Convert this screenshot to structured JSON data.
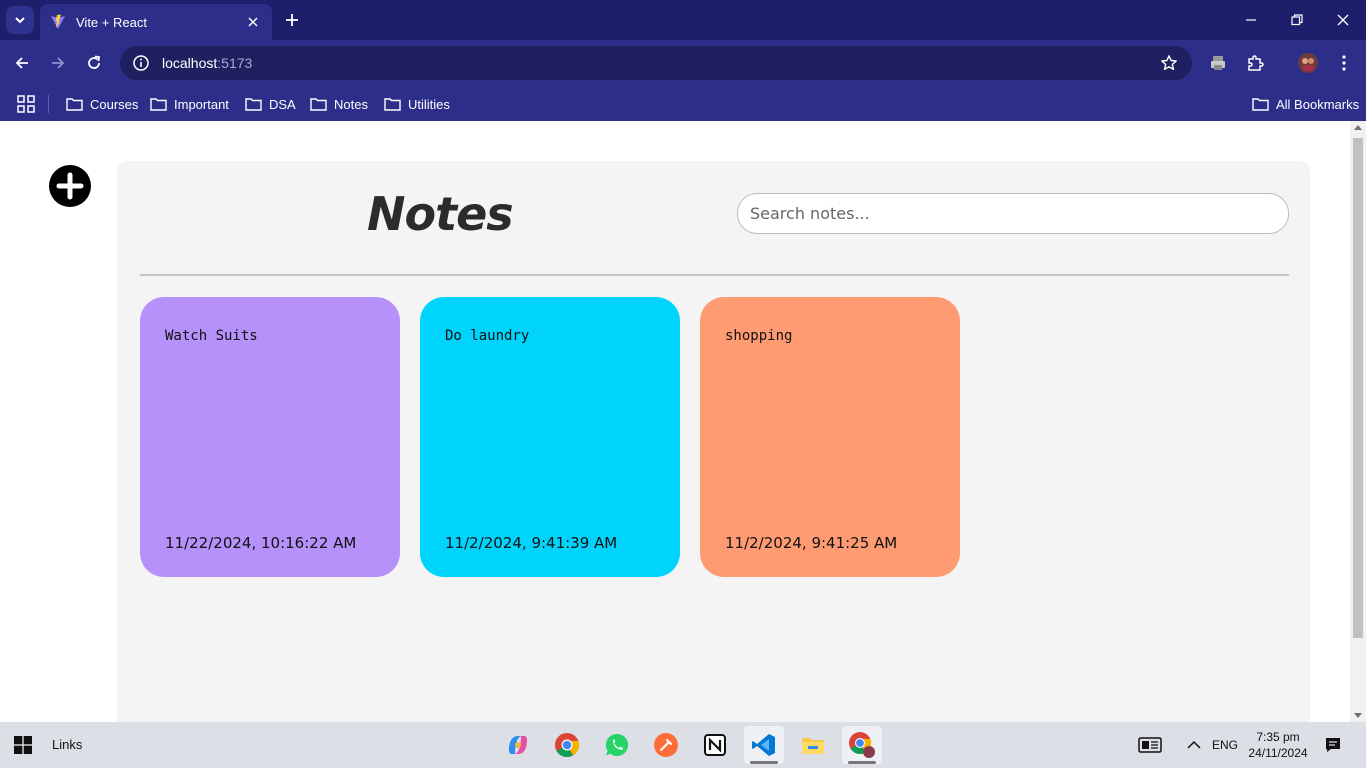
{
  "browser": {
    "tab_title": "Vite + React",
    "url_host": "localhost",
    "url_port": ":5173",
    "bookmarks": [
      {
        "label": "Courses"
      },
      {
        "label": "Important"
      },
      {
        "label": "DSA"
      },
      {
        "label": "Notes"
      },
      {
        "label": "Utilities"
      }
    ],
    "all_bookmarks_label": "All Bookmarks"
  },
  "app": {
    "title": "Notes",
    "search_placeholder": "Search notes...",
    "notes": [
      {
        "text": "Watch Suits",
        "date": "11/22/2024, 10:16:22 AM",
        "color": "#b591f9"
      },
      {
        "text": "Do laundry",
        "date": "11/2/2024, 9:41:39 AM",
        "color": "#00d4fd"
      },
      {
        "text": "shopping",
        "date": "11/2/2024, 9:41:25 AM",
        "color": "#fe9b72"
      }
    ]
  },
  "taskbar": {
    "links_label": "Links",
    "language": "ENG",
    "time": "7:35 pm",
    "date": "24/11/2024"
  }
}
